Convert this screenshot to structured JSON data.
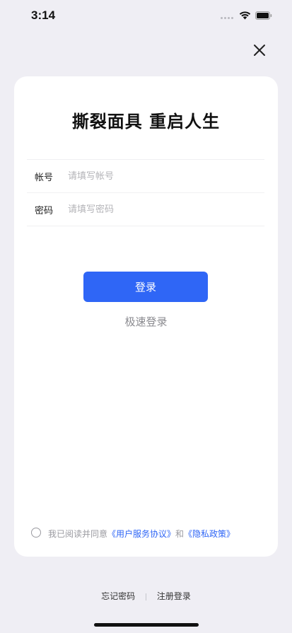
{
  "status_bar": {
    "time": "3:14"
  },
  "card": {
    "title": "撕裂面具  重启人生",
    "account": {
      "label": "帐号",
      "placeholder": "请填写帐号",
      "value": ""
    },
    "password": {
      "label": "密码",
      "placeholder": "请填写密码",
      "value": ""
    },
    "login_button": "登录",
    "quick_login": "极速登录",
    "agreement": {
      "prefix": "我已阅读并同意",
      "user_agreement": "《用户服务协议》",
      "conjunction": "和",
      "privacy_policy": "《隐私政策》",
      "checked": false
    }
  },
  "footer": {
    "forgot_password": "忘记密码",
    "register": "注册登录"
  },
  "colors": {
    "background": "#efeef4",
    "accent": "#2f66f6",
    "card": "#ffffff"
  },
  "icons": [
    "signal-icon",
    "wifi-icon",
    "battery-icon",
    "close-icon"
  ]
}
